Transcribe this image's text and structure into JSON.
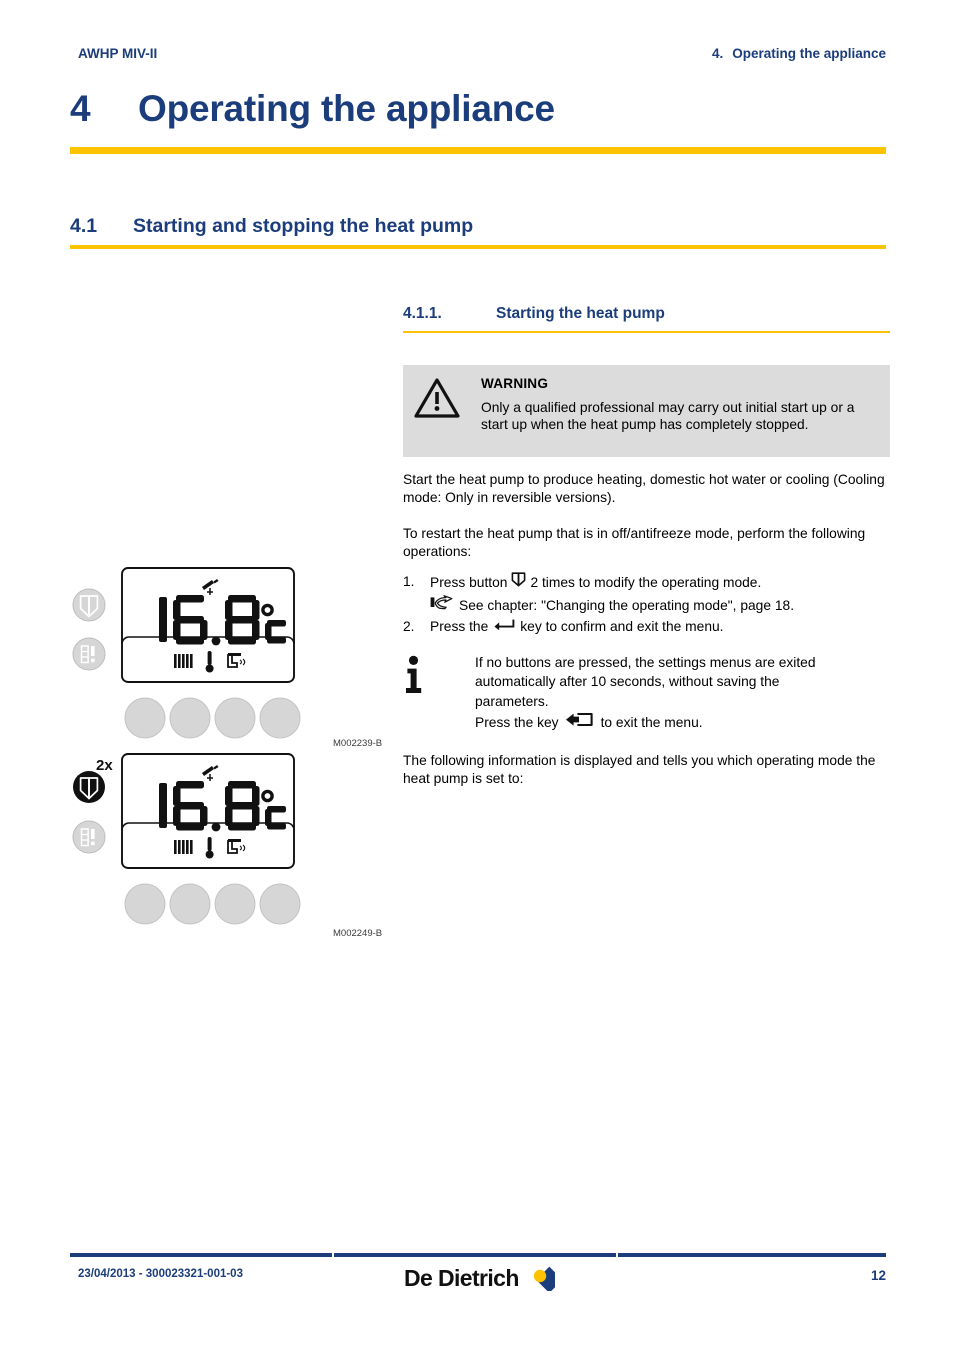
{
  "header": {
    "left": "AWHP MIV-II",
    "right_number": "4.",
    "right_title": "Operating the appliance"
  },
  "chapter": {
    "number": "4",
    "title": "Operating the appliance"
  },
  "section": {
    "number": "4.1",
    "title": "Starting and stopping the heat pump"
  },
  "subsection": {
    "number": "4.1.1.",
    "title": "Starting the heat pump"
  },
  "warning": {
    "icon": "warning-triangle-icon",
    "title": "WARNING",
    "text": "Only a qualified professional may carry out initial start up or a start up when the heat pump has completely stopped."
  },
  "paragraphs": {
    "intro": "Start the heat pump to produce heating, domestic hot water or cooling (Cooling mode: Only in reversible versions).",
    "restart": "To restart the heat pump that is in off/antifreeze mode, perform the following operations:",
    "closing": "The following information is displayed and tells you which operating mode the heat pump is set to:"
  },
  "steps": [
    {
      "marker": "1.",
      "text_before": "Press button",
      "icon": "mode-button-icon",
      "text_after": "2 times to modify the operating mode."
    },
    {
      "marker": "2.",
      "text_before": "Press the",
      "icon": "enter-key-icon",
      "text_after": "key to confirm and exit the menu."
    }
  ],
  "cross_reference": {
    "icon": "pointing-hand-icon",
    "text": "See chapter:  \"Changing the operating mode\", page 18."
  },
  "note": {
    "icon": "information-icon",
    "line1": "If no buttons are pressed, the settings menus are exited",
    "line2": "automatically after 10 seconds, without saving the",
    "line3": "parameters.",
    "line4_before": "Press the key",
    "line4_icon": "exit-key-icon",
    "line4_after": "to exit the menu."
  },
  "illustrations": [
    {
      "reference": "M002239-B",
      "display_value": "16.8",
      "display_unit": "°C",
      "top_icon": "cooling-fan-icon",
      "status_icons": [
        "radiator-icon",
        "thermometer-icon",
        "hot-water-tap-icon"
      ],
      "mode_button_state": "inactive",
      "repeat_label": "",
      "button_count": 4
    },
    {
      "reference": "M002249-B",
      "display_value": "16.8",
      "display_unit": "°C",
      "top_icon": "cooling-fan-icon",
      "status_icons": [
        "radiator-icon",
        "thermometer-icon",
        "hot-water-tap-icon"
      ],
      "mode_button_state": "active",
      "repeat_label": "2x",
      "button_count": 4
    }
  ],
  "footer": {
    "document_id": "23/04/2013 - 300023321-001-03",
    "brand": "De Dietrich",
    "brand_icon": "de-dietrich-diamond-logo",
    "page_number": "12"
  },
  "colors": {
    "brand_blue": "#1b3d7b",
    "accent_gold": "#fdc300",
    "warning_bg": "#dcdcdc",
    "button_grey": "#d4d4d4"
  }
}
